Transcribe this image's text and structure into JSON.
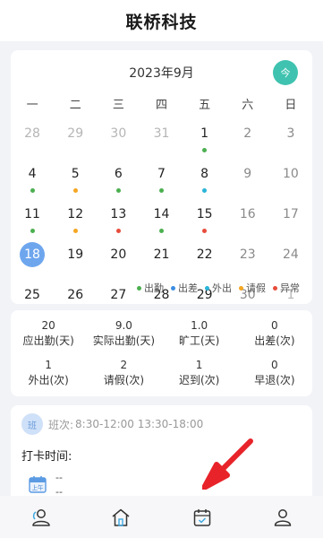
{
  "header": {
    "title": "联桥科技"
  },
  "calendar": {
    "month_title": "2023年9月",
    "today_label": "今",
    "weekdays": [
      "一",
      "二",
      "三",
      "四",
      "五",
      "六",
      "日"
    ],
    "weeks": [
      [
        {
          "d": "28",
          "other": true
        },
        {
          "d": "29",
          "other": true
        },
        {
          "d": "30",
          "other": true
        },
        {
          "d": "31",
          "other": true
        },
        {
          "d": "1",
          "dot": "#4caf50"
        },
        {
          "d": "2",
          "weekend": true
        },
        {
          "d": "3",
          "weekend": true
        }
      ],
      [
        {
          "d": "4",
          "dot": "#4caf50"
        },
        {
          "d": "5",
          "dot": "#f5a623"
        },
        {
          "d": "6",
          "dot": "#4caf50"
        },
        {
          "d": "7",
          "dot": "#4caf50"
        },
        {
          "d": "8",
          "dot": "#2ab4d8"
        },
        {
          "d": "9",
          "weekend": true
        },
        {
          "d": "10",
          "weekend": true
        }
      ],
      [
        {
          "d": "11",
          "dot": "#4caf50"
        },
        {
          "d": "12",
          "dot": "#f5a623"
        },
        {
          "d": "13",
          "dot": "#e74c3c"
        },
        {
          "d": "14",
          "dot": "#4caf50"
        },
        {
          "d": "15",
          "dot": "#e74c3c"
        },
        {
          "d": "16",
          "weekend": true
        },
        {
          "d": "17",
          "weekend": true
        }
      ],
      [
        {
          "d": "18",
          "selected": true
        },
        {
          "d": "19"
        },
        {
          "d": "20"
        },
        {
          "d": "21"
        },
        {
          "d": "22"
        },
        {
          "d": "23",
          "weekend": true
        },
        {
          "d": "24",
          "weekend": true
        }
      ],
      [
        {
          "d": "25"
        },
        {
          "d": "26"
        },
        {
          "d": "27"
        },
        {
          "d": "28"
        },
        {
          "d": "29"
        },
        {
          "d": "30",
          "weekend": true
        },
        {
          "d": "1",
          "other": true
        }
      ]
    ],
    "legend": [
      {
        "label": "出勤",
        "color": "#4caf50"
      },
      {
        "label": "出差",
        "color": "#3b8de0"
      },
      {
        "label": "外出",
        "color": "#2ab4d8"
      },
      {
        "label": "请假",
        "color": "#f5a623"
      },
      {
        "label": "异常",
        "color": "#e74c3c"
      }
    ]
  },
  "stats": [
    {
      "value": "20",
      "label": "应出勤(天)"
    },
    {
      "value": "9.0",
      "label": "实际出勤(天)"
    },
    {
      "value": "1.0",
      "label": "旷工(天)"
    },
    {
      "value": "0",
      "label": "出差(次)"
    },
    {
      "value": "1",
      "label": "外出(次)"
    },
    {
      "value": "2",
      "label": "请假(次)"
    },
    {
      "value": "1",
      "label": "迟到(次)"
    },
    {
      "value": "0",
      "label": "早退(次)"
    }
  ],
  "shift": {
    "badge": "班",
    "label": "班次:",
    "time": "8:30-12:00  13:30-18:00",
    "punch_title": "打卡时间:",
    "am_label": "上午",
    "dash1": "--",
    "dash2": "--"
  },
  "colors": {
    "accent": "#3fc3b0",
    "selected": "#6ea6ee",
    "arrow": "#e8232a"
  },
  "nav_icons": [
    "contacts-icon",
    "home-icon",
    "attendance-calendar-icon",
    "profile-icon"
  ]
}
